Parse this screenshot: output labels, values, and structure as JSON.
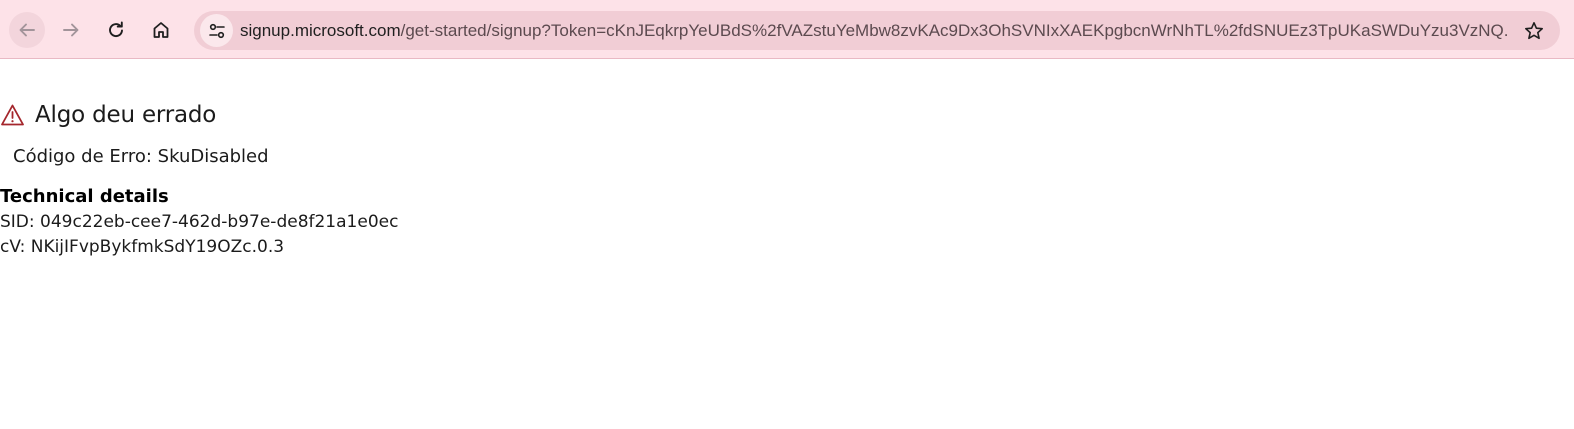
{
  "browser": {
    "url_host": "signup.microsoft.com",
    "url_rest": "/get-started/signup?Token=cKnJEqkrpYeUBdS%2fVAZstuYeMbw8zvKAc9Dx3OhSVNIxXAEKpgbcnWrNhTL%2fdSNUEz3TpUKaSWDuYzu3VzNQ...",
    "icons": {
      "back": "arrow-left-icon",
      "forward": "arrow-right-icon",
      "reload": "reload-icon",
      "home": "home-icon",
      "site_info": "tune-icon",
      "bookmark": "star-icon"
    },
    "colors": {
      "toolbar_bg": "#fde2e8",
      "omnibox_bg": "#f1cdd5"
    }
  },
  "page": {
    "error_title": "Algo deu errado",
    "error_code": "Código de Erro: SkuDisabled",
    "technical_details_title": "Technical details",
    "sid": "SID: 049c22eb-cee7-462d-b97e-de8f21a1e0ec",
    "cv": "cV: NKijIFvpBykfmkSdY19OZc.0.3",
    "warning_icon": "warning-triangle-icon",
    "warning_color": "#a4262c"
  }
}
